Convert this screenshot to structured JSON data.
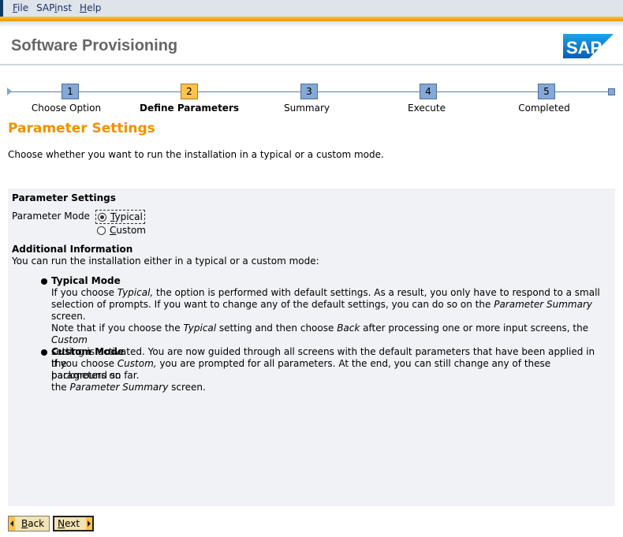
{
  "menu": {
    "items": [
      {
        "mnemonic": "F",
        "rest": "ile"
      },
      {
        "pre": "SAP",
        "mnemonic": "i",
        "rest": "nst"
      },
      {
        "mnemonic": "H",
        "rest": "elp"
      }
    ]
  },
  "header": {
    "title": "Software Provisioning",
    "logo_text": "SAP"
  },
  "roadmap": {
    "steps": [
      {
        "number": "1",
        "label": "Choose Option",
        "active": false
      },
      {
        "number": "2",
        "label": "Define Parameters",
        "active": true
      },
      {
        "number": "3",
        "label": "Summary",
        "active": false
      },
      {
        "number": "4",
        "label": "Execute",
        "active": false
      },
      {
        "number": "5",
        "label": "Completed",
        "active": false
      }
    ]
  },
  "page": {
    "heading": "Parameter Settings",
    "intro": "Choose whether you want to run the installation in a typical or a custom mode."
  },
  "panel": {
    "title": "Parameter Settings",
    "mode_label": "Parameter Mode",
    "options": [
      {
        "mnemonic": "T",
        "rest": "ypical",
        "selected": true
      },
      {
        "mnemonic": "C",
        "rest": "ustom",
        "selected": false
      }
    ],
    "additional_title": "Additional Information",
    "additional_text": "You can run the installation either in a typical or a custom mode:",
    "bullets": [
      {
        "title": "Typical Mode",
        "lines": [
          [
            {
              "t": "If you choose "
            },
            {
              "t": "Typical,",
              "i": true
            },
            {
              "t": " the option is performed with default settings. As a result, you only have to respond to a small"
            }
          ],
          [
            {
              "t": "selection of prompts. If you want to change any of the default settings, you can do so on the "
            },
            {
              "t": "Parameter Summary",
              "i": true
            },
            {
              "t": " screen."
            }
          ],
          [
            {
              "t": "Note that if you choose the "
            },
            {
              "t": "Typical",
              "i": true
            },
            {
              "t": " setting and then choose "
            },
            {
              "t": "Back",
              "i": true
            },
            {
              "t": " after processing one or more input screens, the "
            },
            {
              "t": "Custom",
              "i": true
            }
          ],
          [
            {
              "t": "setting is activated. You are now guided through all screens with the default parameters that have been applied in the"
            }
          ],
          [
            {
              "t": "background so far."
            }
          ]
        ]
      },
      {
        "title": "Custom Mode",
        "lines": [
          [
            {
              "t": "If you choose "
            },
            {
              "t": "Custom,",
              "i": true
            },
            {
              "t": " you are prompted for all parameters. At the end, you can still change any of these parameters on"
            }
          ],
          [
            {
              "t": "the "
            },
            {
              "t": "Parameter Summary",
              "i": true
            },
            {
              "t": " screen."
            }
          ]
        ]
      }
    ]
  },
  "footer": {
    "back": {
      "mnemonic": "B",
      "rest": "ack"
    },
    "next": {
      "mnemonic": "N",
      "rest": "ext"
    }
  },
  "colors": {
    "accent_orange": "#f29100",
    "active_step": "#fdc34a",
    "inactive_step": "#86a8d6",
    "panel_bg": "#f1f2f6"
  }
}
